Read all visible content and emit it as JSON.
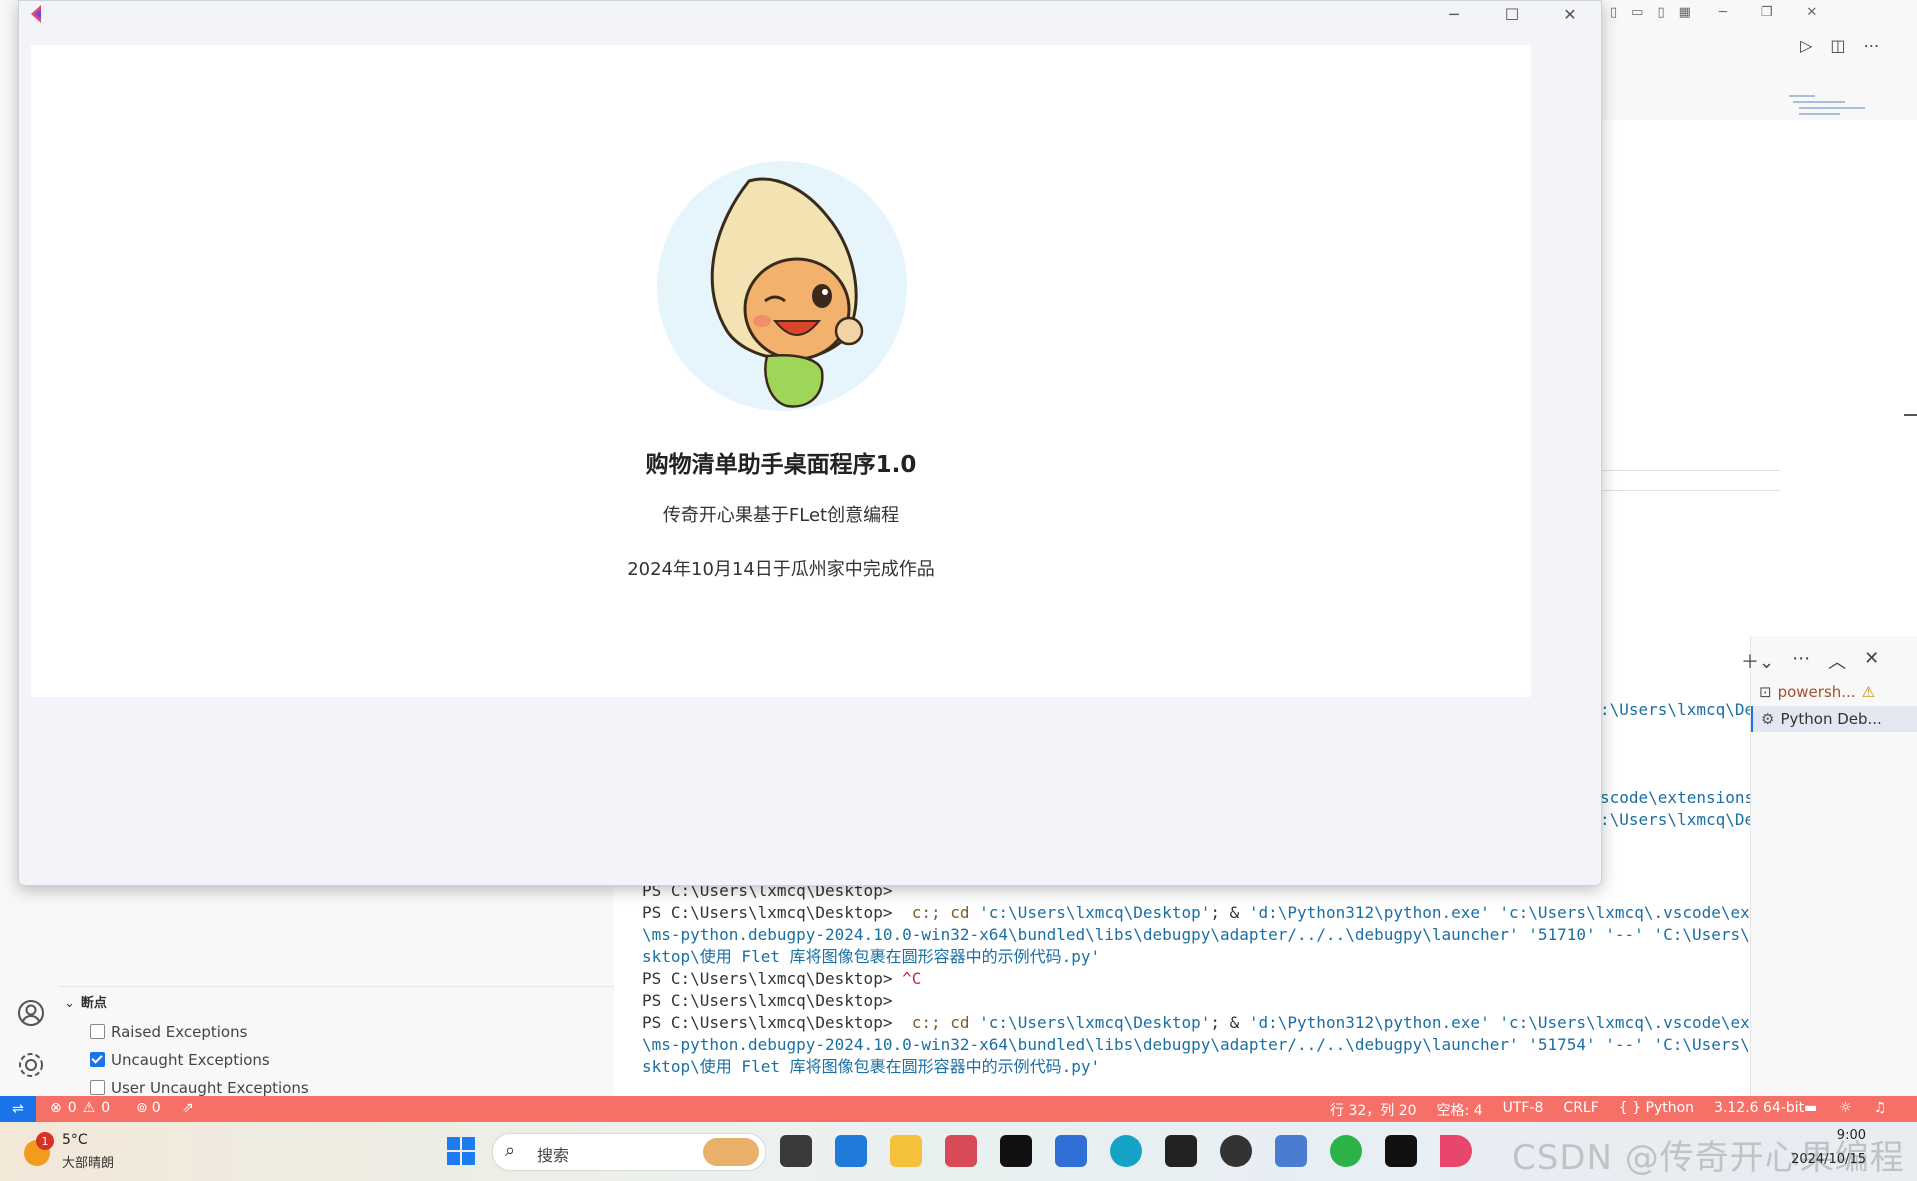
{
  "app": {
    "heading": "购物清单助手桌面程序1.0",
    "subtitle": "传奇开心果基于FLet创意编程",
    "date_line": "2024年10月14日于瓜州家中完成作品"
  },
  "terminal": {
    "lines": [
      "PS C:\\Users\\lxmcq\\Desktop>",
      "PS C:\\Users\\lxmcq\\Desktop>",
      "\\ms-python.debugpy-2024.10.0-win32-x64\\bundled\\libs\\debugpy\\adapter/../..\\debugpy\\launcher' '51710' '--' 'C:\\Users\\lxmcq\\De",
      "sktop\\使用 Flet 库将图像包裹在圆形容器中的示例代码.py'",
      "PS C:\\Users\\lxmcq\\Desktop>",
      "PS C:\\Users\\lxmcq\\Desktop>",
      "PS C:\\Users\\lxmcq\\Desktop>",
      "\\ms-python.debugpy-2024.10.0-win32-x64\\bundled\\libs\\debugpy\\adapter/../..\\debugpy\\launcher' '51754' '--' 'C:\\Users\\lxmcq\\De",
      "sktop\\使用 Flet 库将图像包裹在圆形容器中的示例代码.py'"
    ],
    "cmd_part1": "c:; cd ",
    "cmd_path": "'c:\\Users\\lxmcq\\Desktop'",
    "cmd_part2": "; & ",
    "cmd_exe": "'d:\\Python312\\python.exe' 'c:\\Users\\lxmcq\\.vscode\\extensions",
    "ctrl_c": "^C",
    "right_frag1": ":\\Users\\lxmcq\\De",
    "right_frag2": "scode\\extensions",
    "right_frag3": ":\\Users\\lxmcq\\De",
    "tabs": [
      "powersh...",
      "Python Deb..."
    ]
  },
  "breakpoints": {
    "title": "断点",
    "items": [
      {
        "label": "Raised Exceptions",
        "checked": false
      },
      {
        "label": "Uncaught Exceptions",
        "checked": true
      },
      {
        "label": "User Uncaught Exceptions",
        "checked": false
      }
    ]
  },
  "status": {
    "errors": "0",
    "warnings": "0",
    "ports": "0",
    "position": "行 32，列 20",
    "spaces": "空格: 4",
    "encoding": "UTF-8",
    "eol": "CRLF",
    "language": "{ } Python",
    "interpreter": "3.12.6 64-bit"
  },
  "taskbar": {
    "weather_temp": "5°C",
    "weather_desc": "大部晴朗",
    "weather_badge": "1",
    "search_placeholder": "搜索",
    "time": "9:00",
    "date": "2024/10/15",
    "watermark": "CSDN @传奇开心果编程"
  },
  "colors": {
    "status_bar": "#f57168",
    "accent_blue": "#1a73e8"
  }
}
